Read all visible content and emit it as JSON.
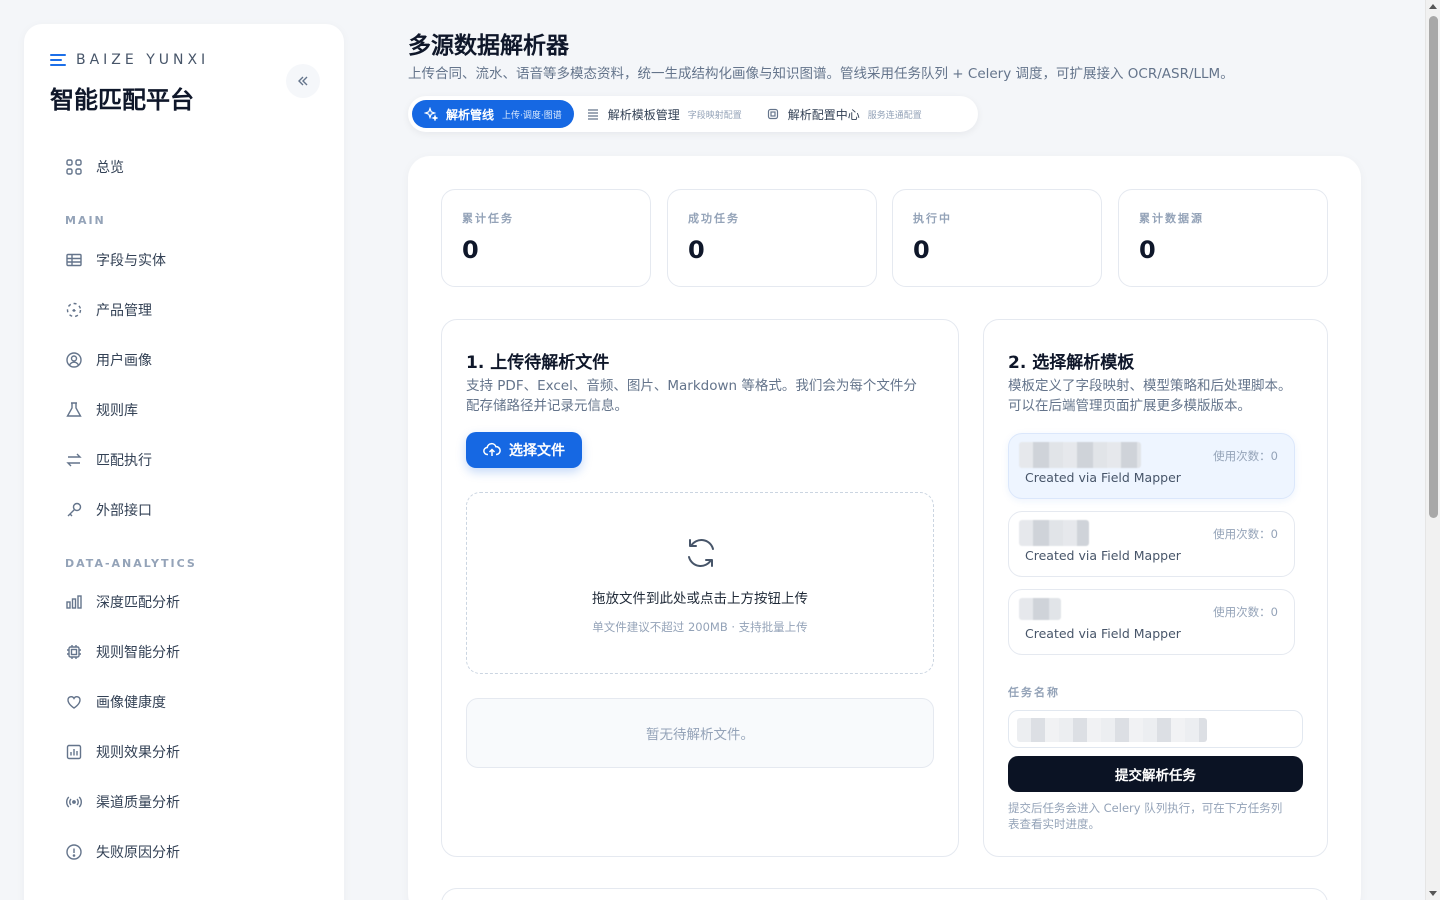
{
  "brand": {
    "eyebrow": "BAIZE YUNXI",
    "title": "智能匹配平台"
  },
  "sidebar": {
    "overview": "总览",
    "section_main": "MAIN",
    "main_items": [
      "字段与实体",
      "产品管理",
      "用户画像",
      "规则库",
      "匹配执行",
      "外部接口"
    ],
    "section_analytics": "DATA-ANALYTICS",
    "analytics_items": [
      "深度匹配分析",
      "规则智能分析",
      "画像健康度",
      "规则效果分析",
      "渠道质量分析",
      "失败原因分析"
    ]
  },
  "header": {
    "title": "多源数据解析器",
    "subtitle": "上传合同、流水、语音等多模态资料，统一生成结构化画像与知识图谱。管线采用任务队列 + Celery 调度，可扩展接入 OCR/ASR/LLM。"
  },
  "tabs": [
    {
      "label": "解析管线",
      "sub": "上传·调度·图谱",
      "active": true,
      "icon": "sparkle-icon"
    },
    {
      "label": "解析模板管理",
      "sub": "字段映射配置",
      "active": false,
      "icon": "list-icon"
    },
    {
      "label": "解析配置中心",
      "sub": "服务连通配置",
      "active": false,
      "icon": "chip-icon"
    }
  ],
  "stats": [
    {
      "label": "累计任务",
      "value": "0"
    },
    {
      "label": "成功任务",
      "value": "0"
    },
    {
      "label": "执行中",
      "value": "0"
    },
    {
      "label": "累计数据源",
      "value": "0"
    }
  ],
  "upload": {
    "title": "1. 上传待解析文件",
    "desc_line1": "支持 PDF、Excel、音频、图片、Markdown 等格式。我们会为每个文件分",
    "desc_line2": "配存储路径并记录元信息。",
    "button": "选择文件",
    "drop_title": "拖放文件到此处或点击上方按钮上传",
    "drop_hint": "单文件建议不超过 200MB · 支持批量上传",
    "empty": "暂无待解析文件。"
  },
  "templates": {
    "title": "2. 选择解析模板",
    "desc_line1": "模板定义了字段映射、模型策略和后处理脚本。",
    "desc_line2": "可以在后端管理页面扩展更多模版版本。",
    "items": [
      {
        "usage": "使用次数：0",
        "sub": "Created via Field Mapper",
        "selected": true
      },
      {
        "usage": "使用次数：0",
        "sub": "Created via Field Mapper",
        "selected": false
      },
      {
        "usage": "使用次数：0",
        "sub": "Created via Field Mapper",
        "selected": false
      }
    ],
    "task_label": "任务名称",
    "submit": "提交解析任务",
    "hint_line1": "提交后任务会进入 Celery 队列执行，可在下方任务列",
    "hint_line2": "表查看实时进度。"
  },
  "colors": {
    "accent": "#1668e3",
    "dark_button": "#0b1324"
  }
}
